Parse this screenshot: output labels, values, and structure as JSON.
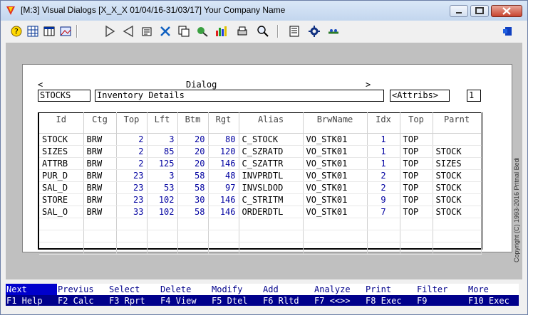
{
  "window": {
    "title": "[M:3]  Visual Dialogs  [X_X_X  01/04/16-31/03/17]  Your Company Name",
    "copyright": "Copyright (C) 1993-2016 Pritnal Bedi"
  },
  "toolbar": {
    "icons": [
      "help-icon",
      "grid-icon",
      "table-icon",
      "picture-icon",
      "play-icon",
      "back-icon",
      "form-icon",
      "tools-icon",
      "copy-icon",
      "spell-icon",
      "chart-icon",
      "print-icon",
      "zoom-icon",
      "notes-icon",
      "settings-icon",
      "wizard-icon",
      "exit-icon"
    ]
  },
  "dialog": {
    "label": "Dialog",
    "left_arrow": "<",
    "right_arrow": ">",
    "code": "STOCKS",
    "description": "Inventory Details",
    "attribs": "<Attribs>",
    "page": "1"
  },
  "table": {
    "headers": [
      "Id",
      "Ctg",
      "Top",
      "Lft",
      "Btm",
      "Rgt",
      "Alias",
      "BrwName",
      "Idx",
      "Top",
      "Parnt"
    ],
    "rows": [
      [
        "STOCK",
        "BRW",
        "2",
        "3",
        "20",
        "80",
        "C_STOCK",
        "VO_STK01",
        "1",
        "TOP",
        ""
      ],
      [
        "SIZES",
        "BRW",
        "2",
        "85",
        "20",
        "120",
        "C_SZRATD",
        "VO_STK01",
        "1",
        "TOP",
        "STOCK"
      ],
      [
        "ATTRB",
        "BRW",
        "2",
        "125",
        "20",
        "146",
        "C_SZATTR",
        "VO_STK01",
        "1",
        "TOP",
        "SIZES"
      ],
      [
        "PUR_D",
        "BRW",
        "23",
        "3",
        "58",
        "48",
        "INVPRDTL",
        "VO_STK01",
        "2",
        "TOP",
        "STOCK"
      ],
      [
        "SAL_D",
        "BRW",
        "23",
        "53",
        "58",
        "97",
        "INVSLDOD",
        "VO_STK01",
        "2",
        "TOP",
        "STOCK"
      ],
      [
        "STORE",
        "BRW",
        "23",
        "102",
        "30",
        "146",
        "C_STRITM",
        "VO_STK01",
        "9",
        "TOP",
        "STOCK"
      ],
      [
        "SAL_O",
        "BRW",
        "33",
        "102",
        "58",
        "146",
        "ORDERDTL",
        "VO_STK01",
        "7",
        "TOP",
        "STOCK"
      ],
      [
        "",
        "",
        "",
        "",
        "",
        "",
        "",
        "",
        "",
        "",
        ""
      ],
      [
        "",
        "",
        "",
        "",
        "",
        "",
        "",
        "",
        "",
        "",
        ""
      ],
      [
        "",
        "",
        "",
        "",
        "",
        "",
        "",
        "",
        "",
        "",
        ""
      ]
    ]
  },
  "fkeys": [
    {
      "top": "Next",
      "bottom": "F1 Help",
      "active": true
    },
    {
      "top": "Previus",
      "bottom": "F2 Calc"
    },
    {
      "top": "Select",
      "bottom": "F3 Rprt"
    },
    {
      "top": "Delete",
      "bottom": "F4 View"
    },
    {
      "top": "Modify",
      "bottom": "F5 Dtel"
    },
    {
      "top": "Add",
      "bottom": "F6 Rltd"
    },
    {
      "top": "Analyze",
      "bottom": "F7 <<>>"
    },
    {
      "top": "Print",
      "bottom": "F8 Exec"
    },
    {
      "top": "Filter",
      "bottom": "F9"
    },
    {
      "top": "More",
      "bottom": "F10 Exec"
    }
  ],
  "colors": {
    "accent": "#00008b",
    "number_text": "#0000a0",
    "client_bg": "#c0c0c0"
  }
}
